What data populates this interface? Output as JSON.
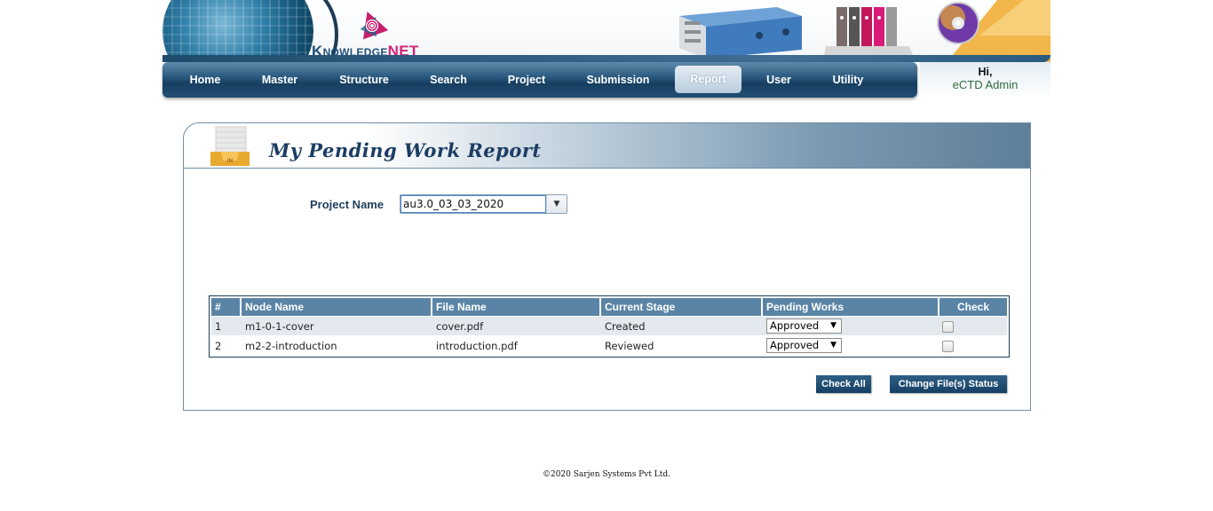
{
  "brand": {
    "logo_knowledge": "Knowledge",
    "logo_net": "NET"
  },
  "nav": {
    "items": [
      {
        "label": "Home"
      },
      {
        "label": "Master"
      },
      {
        "label": "Structure"
      },
      {
        "label": "Search"
      },
      {
        "label": "Project"
      },
      {
        "label": "Submission"
      },
      {
        "label": "Report",
        "active": true
      },
      {
        "label": "User"
      },
      {
        "label": "Utility"
      }
    ]
  },
  "user": {
    "greeting": "Hi,",
    "name": "eCTD Admin"
  },
  "report": {
    "title": "My Pending Work Report",
    "project_label": "Project Name",
    "project_value": "au3.0_03_03_2020",
    "icon": "inbox-folder-icon"
  },
  "table": {
    "columns": [
      "#",
      "Node Name",
      "File Name",
      "Current Stage",
      "Pending Works",
      "Check"
    ],
    "rows": [
      {
        "num": "1",
        "node": "m1-0-1-cover",
        "file": "cover.pdf",
        "stage": "Created",
        "pending": "Approved",
        "checked": false
      },
      {
        "num": "2",
        "node": "m2-2-introduction",
        "file": "introduction.pdf",
        "stage": "Reviewed",
        "pending": "Approved",
        "checked": false
      }
    ]
  },
  "buttons": {
    "check_all": "Check All",
    "change_status": "Change File(s) Status"
  },
  "footer": {
    "text": "©2020 Sarjen Systems Pvt Ltd."
  },
  "colors": {
    "nav_dark": "#163e60",
    "header_cell": "#5a84a5",
    "title": "#1c3d63",
    "accent_pink": "#d4237a"
  }
}
